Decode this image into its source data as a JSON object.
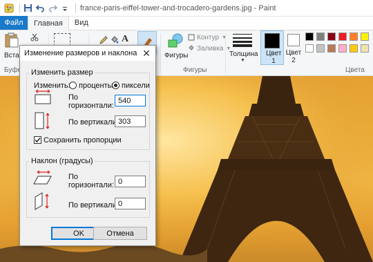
{
  "window": {
    "title": "france-paris-eiffel-tower-and-trocadero-gardens.jpg - Paint"
  },
  "ribbon": {
    "tabs": [
      {
        "label": "Файл"
      },
      {
        "label": "Главная"
      },
      {
        "label": "Вид"
      }
    ],
    "paste_label": "Встав",
    "clipboard_group_label": "Буфер",
    "shapes_label": "Фигуры",
    "outline_label": "Контур",
    "fill_label": "Заливка",
    "shapes_group_label": "Фигуры",
    "thickness_label": "Толщина",
    "color1_label": "Цвет 1",
    "color2_label": "Цвет 2",
    "colors_group_label": "Цвета",
    "palette_row1": [
      "#000000",
      "#7f7f7f",
      "#880015",
      "#ed1c24",
      "#ff7f27",
      "#fff200"
    ],
    "palette_row2": [
      "#ffffff",
      "#c3c3c3",
      "#b97a57",
      "#ffaec9",
      "#ffc90e",
      "#efe4b0"
    ]
  },
  "dialog": {
    "title": "Изменение размеров и наклона",
    "resize_group": "Изменить размер",
    "by_label": "Изменить:",
    "percent_label": "проценты",
    "pixels_label": "пиксели",
    "selected_unit": "пиксели",
    "horizontal_label_1": "По",
    "horizontal_label_2": "горизонтали:",
    "vertical_label": "По вертикали:",
    "width_value": "540",
    "height_value": "303",
    "keep_ratio_label": "Сохранить пропорции",
    "keep_ratio_checked": true,
    "skew_group": "Наклон (градусы)",
    "skew_h_label_1": "По",
    "skew_h_label_2": "горизонтали:",
    "skew_v_label": "По вертикали:",
    "skew_h_value": "0",
    "skew_v_value": "0",
    "ok_label": "OK",
    "cancel_label": "Отмена"
  }
}
